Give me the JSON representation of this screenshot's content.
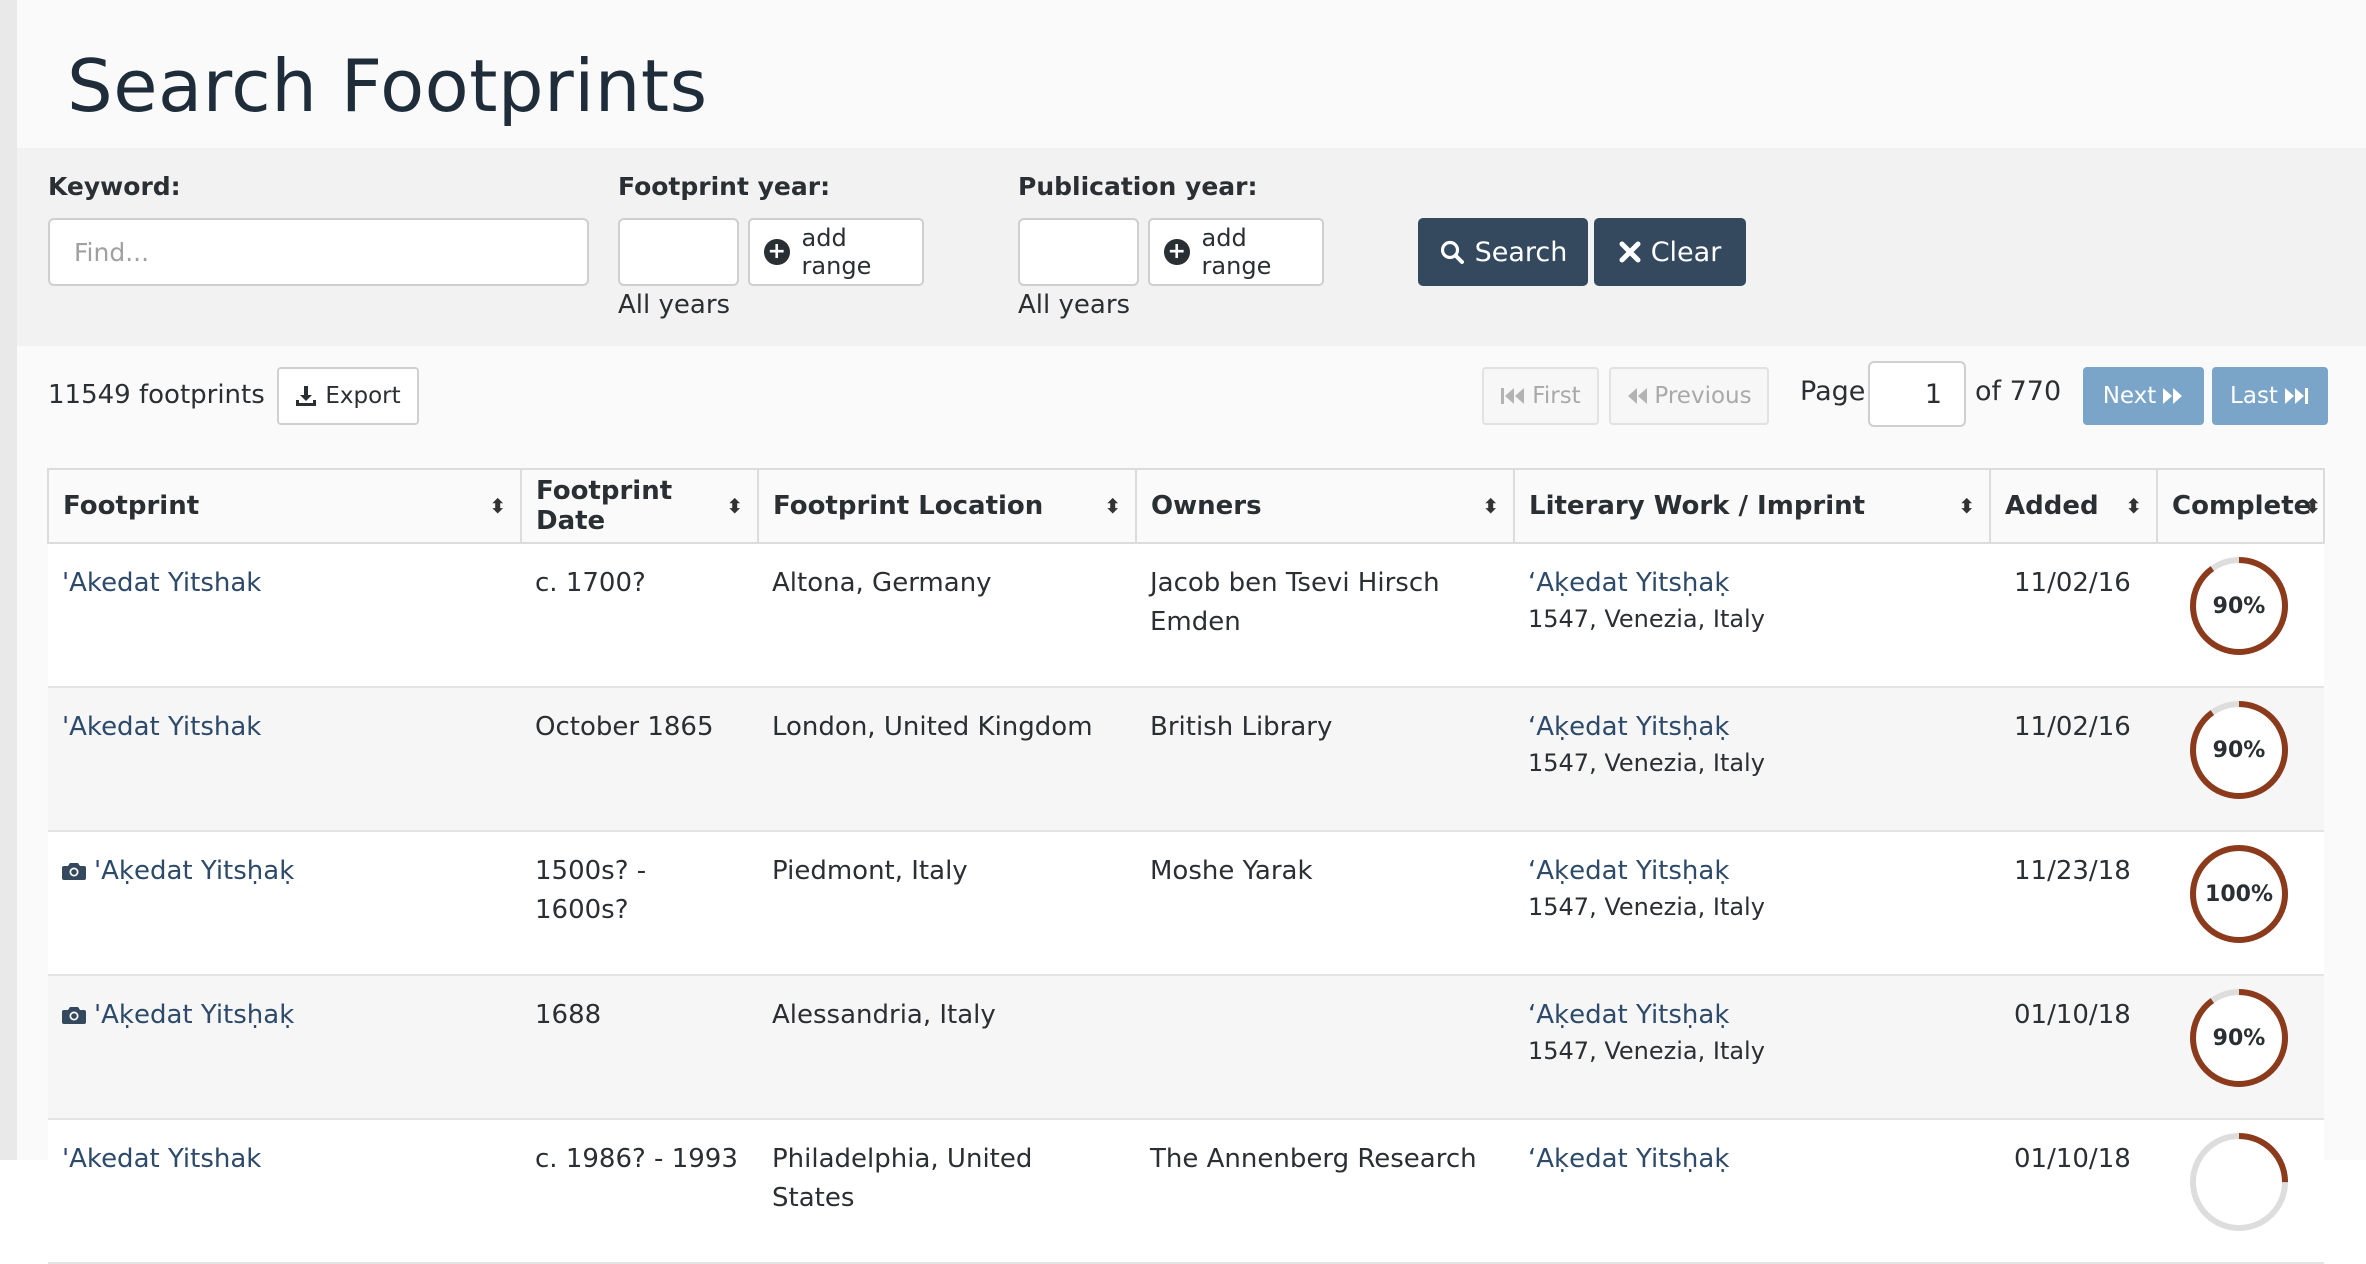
{
  "page": {
    "title": "Search Footprints"
  },
  "filters": {
    "keyword": {
      "label": "Keyword:",
      "placeholder": "Find...",
      "value": ""
    },
    "footprint_year": {
      "label": "Footprint year:",
      "value": "",
      "add_range": "add range",
      "hint": "All years"
    },
    "publication_year": {
      "label": "Publication year:",
      "value": "",
      "add_range": "add range",
      "hint": "All years"
    },
    "search_label": "Search",
    "clear_label": "Clear"
  },
  "results": {
    "count": "11549 footprints",
    "export_label": "Export"
  },
  "pagination": {
    "first": "First",
    "previous": "Previous",
    "page_label": "Page",
    "current": "1",
    "of_label": "of 770",
    "next": "Next",
    "last": "Last"
  },
  "table": {
    "columns": [
      "Footprint",
      "Footprint Date",
      "Footprint Location",
      "Owners",
      "Literary Work / Imprint",
      "Added",
      "Complete"
    ],
    "rows": [
      {
        "footprint": "'Akedat Yitshak",
        "has_image": false,
        "date": "c. 1700?",
        "location": "Altona, Germany",
        "owners": "Jacob ben Tsevi Hirsch Emden",
        "work": "‘Aḳedat Yitsḥaḳ",
        "imprint": "1547, Venezia, Italy",
        "added": "11/02/16",
        "complete": "90%",
        "complete_value": 0.9
      },
      {
        "footprint": "'Akedat Yitshak",
        "has_image": false,
        "date": "October 1865",
        "location": "London, United Kingdom",
        "owners": "British Library",
        "work": "‘Aḳedat Yitsḥaḳ",
        "imprint": "1547, Venezia, Italy",
        "added": "11/02/16",
        "complete": "90%",
        "complete_value": 0.9
      },
      {
        "footprint": "'Aḳedat Yitsḥaḳ",
        "has_image": true,
        "date": "1500s? - 1600s?",
        "location": "Piedmont, Italy",
        "owners": "Moshe Yarak",
        "work": "‘Aḳedat Yitsḥaḳ",
        "imprint": "1547, Venezia, Italy",
        "added": "11/23/18",
        "complete": "100%",
        "complete_value": 1.0
      },
      {
        "footprint": "'Aḳedat Yitsḥaḳ",
        "has_image": true,
        "date": "1688",
        "location": "Alessandria, Italy",
        "owners": "",
        "work": "‘Aḳedat Yitsḥaḳ",
        "imprint": "1547, Venezia, Italy",
        "added": "01/10/18",
        "complete": "90%",
        "complete_value": 0.9
      },
      {
        "footprint": "'Akedat Yitshak",
        "has_image": false,
        "date": "c. 1986? - 1993",
        "location": "Philadelphia, United States",
        "owners": "The Annenberg Research",
        "work": "‘Aḳedat Yitsḥaḳ",
        "imprint": "",
        "added": "01/10/18",
        "complete": "",
        "complete_value": 0.25
      }
    ]
  },
  "colors": {
    "primary": "#34495e",
    "pager": "#7aa4c8",
    "link": "#2d4a6a",
    "progress": "#8b3a1c",
    "progress_track": "#dddddd"
  },
  "icons": {
    "search": "search-icon",
    "clear": "close-icon",
    "export": "download-icon",
    "first": "fast-backward-icon",
    "previous": "backward-icon",
    "next": "forward-icon",
    "last": "fast-forward-icon",
    "sort": "sort-icon",
    "image": "camera-icon",
    "add": "plus-circle-icon"
  }
}
